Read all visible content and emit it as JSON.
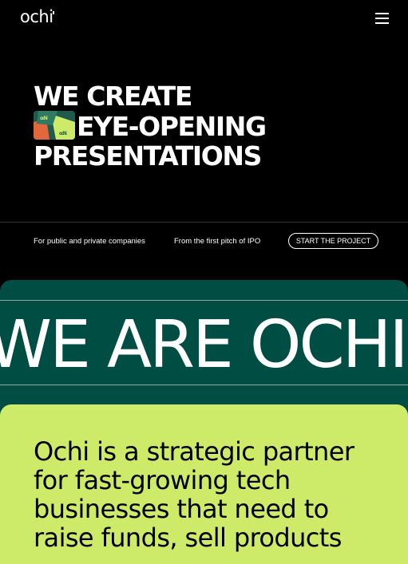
{
  "nav": {
    "logo": "ochi",
    "menu_icon": "hamburger-menu-icon"
  },
  "hero": {
    "line1": "WE CREATE",
    "line2": "EYE-OPENING",
    "line3": "PRESENTATIONS",
    "thumbnail_labels": [
      "ochi",
      "ochi"
    ]
  },
  "subheader": {
    "tag1": "For public and private companies",
    "tag2": "From the first pitch of IPO",
    "cta_label": "START THE PROJECT"
  },
  "marquee": {
    "text": "WE ARE OCHI"
  },
  "about": {
    "text": "Ochi is a strategic partner for fast-growing tech businesses that need to raise funds, sell products"
  },
  "colors": {
    "background": "#000000",
    "marquee_bg": "#004d43",
    "card_bg": "#cdea68",
    "thumbnail_bg": "#1f5b4c",
    "thumbnail_orange": "#e2683c",
    "thumbnail_lime": "#cdea68"
  }
}
